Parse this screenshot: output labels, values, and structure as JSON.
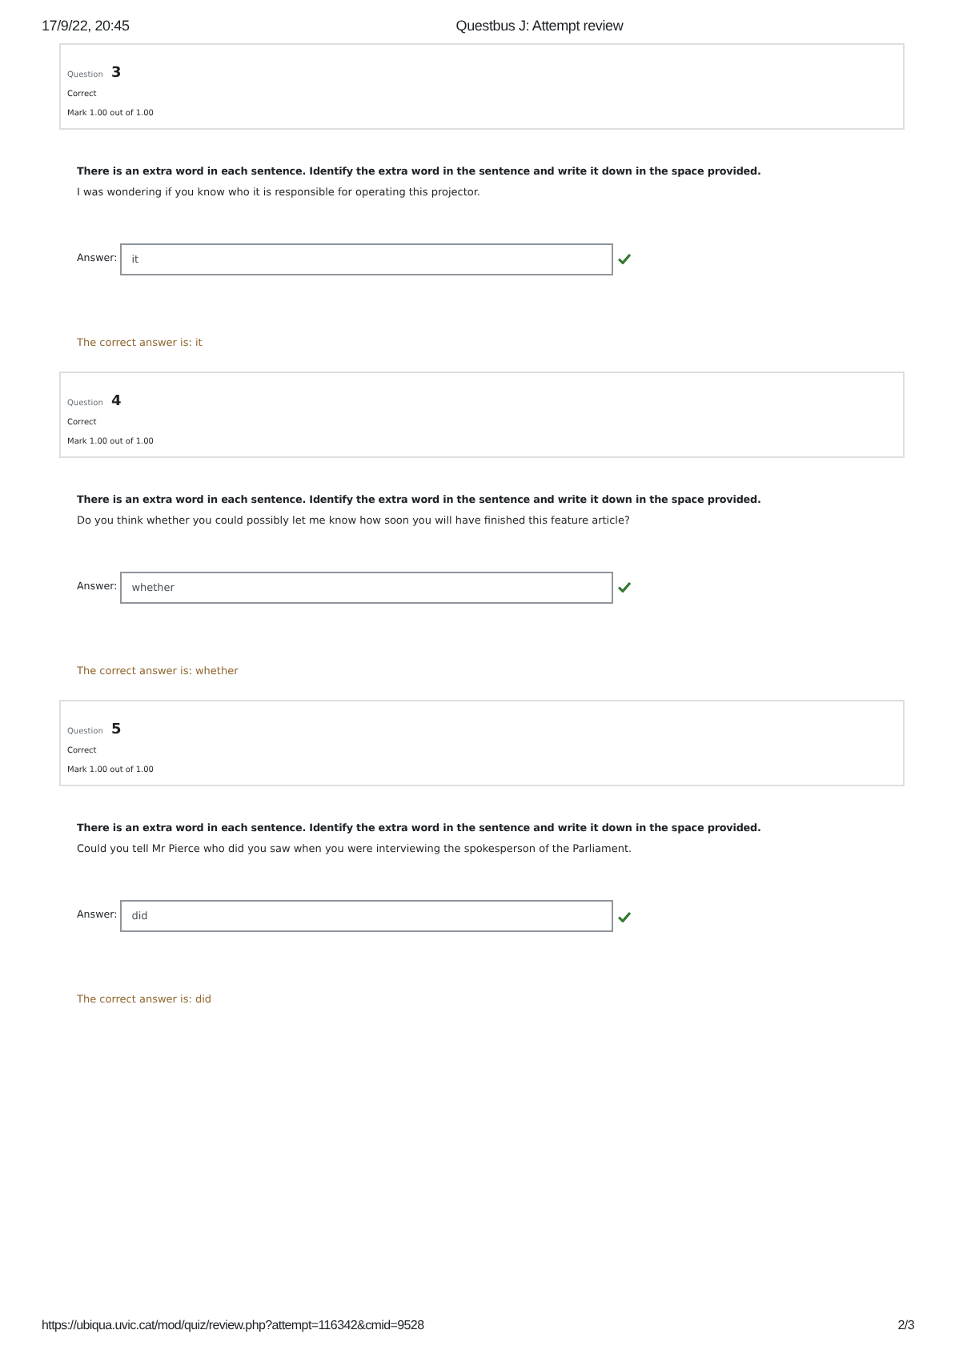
{
  "print_header": {
    "date": "17/9/22, 20:45",
    "title": "Questbus J: Attempt review"
  },
  "questions": [
    {
      "label": "Question",
      "number": "3",
      "state": "Correct",
      "mark": "Mark 1.00 out of 1.00",
      "instruction": "There is an extra word in each sentence. Identify the extra word in the sentence and write it down in the space provided.",
      "sentence": "I was wondering if you know who it is responsible for operating this projector.",
      "answer_label": "Answer:",
      "answer": "it",
      "correct": true,
      "feedback": "The correct answer is: it"
    },
    {
      "label": "Question",
      "number": "4",
      "state": "Correct",
      "mark": "Mark 1.00 out of 1.00",
      "instruction": "There is an extra word in each sentence. Identify the extra word in the sentence and write it down in the space provided.",
      "sentence": "Do you think whether you could possibly let me know how soon you will have finished this feature article?",
      "answer_label": "Answer:",
      "answer": "whether",
      "correct": true,
      "feedback": "The correct answer is: whether"
    },
    {
      "label": "Question",
      "number": "5",
      "state": "Correct",
      "mark": "Mark 1.00 out of 1.00",
      "instruction": "There is an extra word in each sentence. Identify the extra word in the sentence and write it down in the space provided.",
      "sentence": "Could you tell Mr Pierce who did you saw when you were interviewing the spokesperson of the Parliament.",
      "answer_label": "Answer:",
      "answer": "did",
      "correct": true,
      "feedback": "The correct answer is: did"
    }
  ],
  "print_footer": {
    "url": "https://ubiqua.uvic.cat/mod/quiz/review.php?attempt=116342&cmid=9528",
    "page": "2/3"
  }
}
